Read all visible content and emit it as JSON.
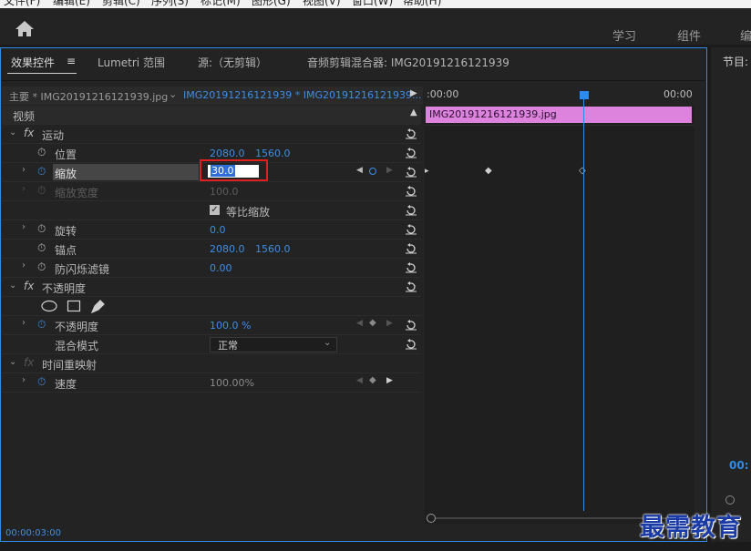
{
  "menubar": {
    "items": [
      "文件(F)",
      "编辑(E)",
      "剪辑(C)",
      "序列(S)",
      "标记(M)",
      "图形(G)",
      "视图(V)",
      "窗口(W)",
      "帮助(H)"
    ]
  },
  "workspaces": {
    "learn": "学习",
    "assembly": "组件",
    "more": "编"
  },
  "tabs": {
    "effect_controls": "效果控件",
    "menu_glyph": "≡",
    "lumetri": "Lumetri 范围",
    "source": "源:（无剪辑）",
    "audio_mixer": "音频剪辑混合器: IMG20191216121939"
  },
  "right_panel": {
    "title": "节目:",
    "timecode": "00:"
  },
  "source_header": {
    "master": "主要 * IMG20191216121939.jpg",
    "sequence": "IMG20191216121939 * IMG20191216121939..."
  },
  "timeline": {
    "start": ":00:00",
    "end": "00:00",
    "clip_name": "IMG20191216121939.jpg"
  },
  "video_label": "视频",
  "motion": {
    "title": "运动",
    "position": {
      "label": "位置",
      "x": "2080.0",
      "y": "1560.0"
    },
    "scale": {
      "label": "缩放",
      "value": "30.0"
    },
    "scale_width": {
      "label": "缩放宽度",
      "value": "100.0"
    },
    "uniform": {
      "label": "等比缩放"
    },
    "rotation": {
      "label": "旋转",
      "value": "0.0"
    },
    "anchor": {
      "label": "锚点",
      "x": "2080.0",
      "y": "1560.0"
    },
    "flicker": {
      "label": "防闪烁滤镜",
      "value": "0.00"
    }
  },
  "opacity": {
    "title": "不透明度",
    "opacity": {
      "label": "不透明度",
      "value": "100.0 %"
    },
    "blend": {
      "label": "混合模式",
      "value": "正常"
    }
  },
  "time_remap": {
    "title": "时间重映射",
    "speed": {
      "label": "速度",
      "value": "100.00%"
    }
  },
  "status": {
    "timecode": "00:00:03:00"
  },
  "watermark": "最需教育",
  "colors": {
    "accent": "#2d8ceb",
    "clip": "#dd82dd",
    "highlight": "#e02020"
  }
}
